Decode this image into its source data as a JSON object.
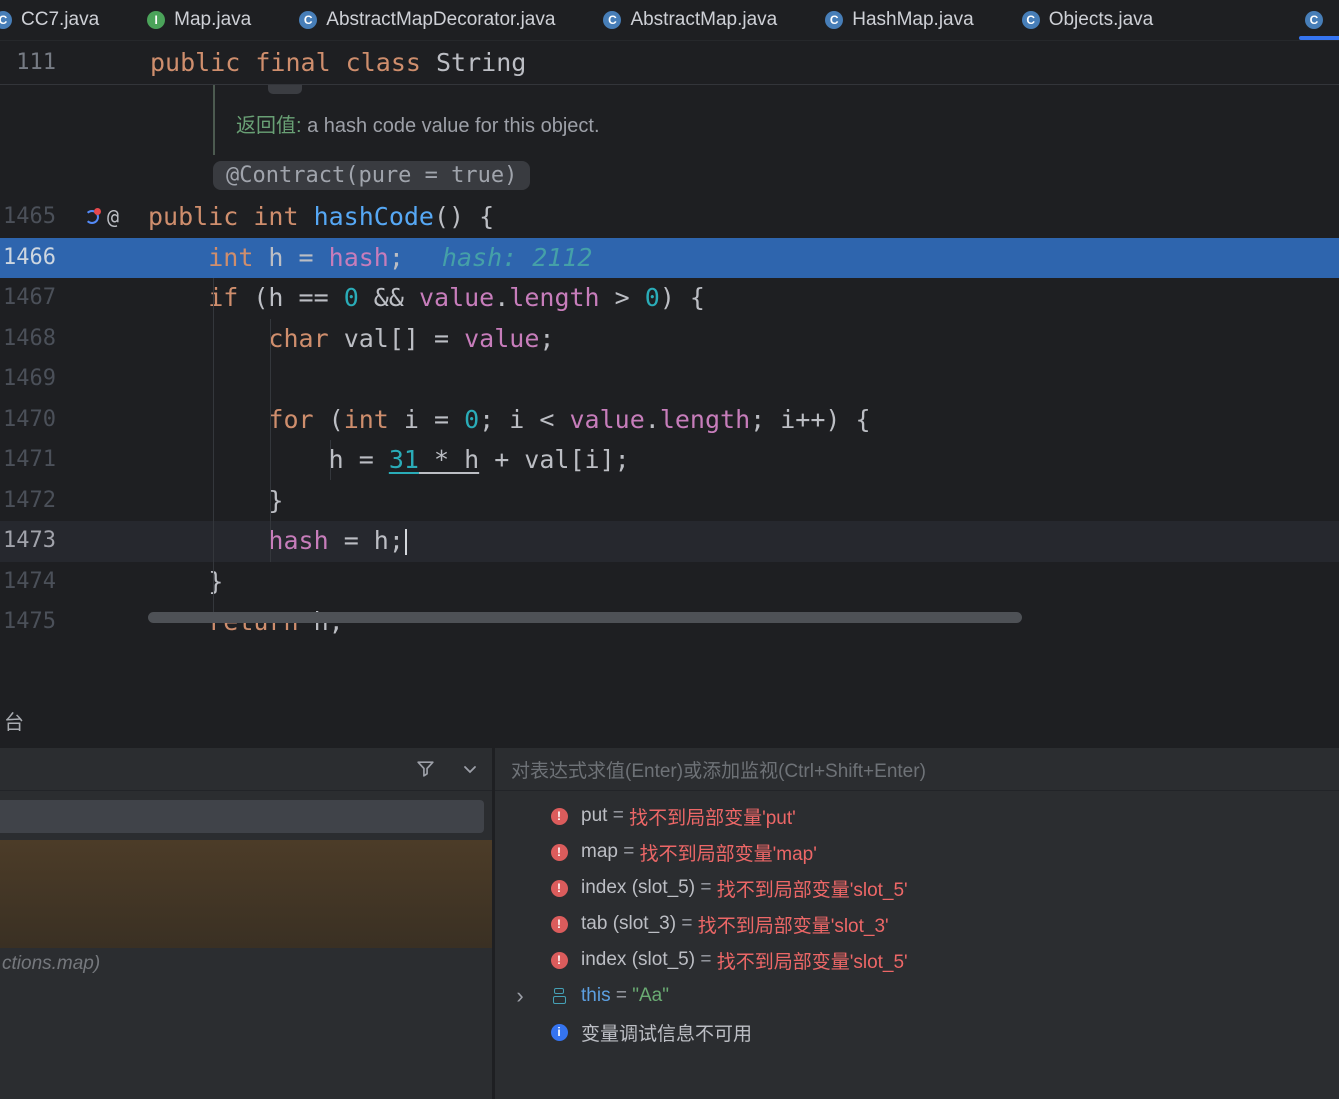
{
  "status_colors": {
    "error": "#DB5C5C",
    "info": "#3574F0",
    "execution_line_bg": "#2E65AE",
    "active_tab_underline": "#3574F0",
    "error_text": "#ED6767",
    "string_green": "#6AAB73"
  },
  "tabs": [
    {
      "label": "CC7.java",
      "icon_letter": "C",
      "icon_color": "#477EB8",
      "icon_kind": "class"
    },
    {
      "label": "Map.java",
      "icon_letter": "I",
      "icon_color": "#4BA35A",
      "icon_kind": "interface"
    },
    {
      "label": "AbstractMapDecorator.java",
      "icon_letter": "C",
      "icon_color": "#477EB8",
      "icon_kind": "class"
    },
    {
      "label": "AbstractMap.java",
      "icon_letter": "C",
      "icon_color": "#477EB8",
      "icon_kind": "class"
    },
    {
      "label": "HashMap.java",
      "icon_letter": "C",
      "icon_color": "#477EB8",
      "icon_kind": "class"
    },
    {
      "label": "Objects.java",
      "icon_letter": "C",
      "icon_color": "#477EB8",
      "icon_kind": "class"
    },
    {
      "label": "",
      "icon_letter": "C",
      "icon_color": "#477EB8",
      "icon_kind": "class",
      "active": true
    }
  ],
  "sticky": {
    "line_number": "111",
    "keyword_text": "public final class ",
    "class_name": "String"
  },
  "editor": {
    "doc": {
      "label": "返回值:",
      "text": " a hash code value for this object."
    },
    "annotation": "@Contract(pure = true)",
    "lines": [
      {
        "num": "1465",
        "gutter_icons": true,
        "tokens": [
          [
            "kw",
            "public int "
          ],
          [
            "fn",
            "hashCode"
          ],
          [
            "pl",
            "() {"
          ]
        ]
      },
      {
        "num": "1466",
        "state": "exec",
        "tokens": [
          [
            "pl",
            "    "
          ],
          [
            "kw",
            "int"
          ],
          [
            "pl",
            " h = "
          ],
          [
            "fld",
            "hash"
          ],
          [
            "pl",
            ";"
          ],
          [
            "hint",
            "hash: 2112"
          ]
        ]
      },
      {
        "num": "1467",
        "tokens": [
          [
            "pl",
            "    "
          ],
          [
            "kw",
            "if"
          ],
          [
            "pl",
            " (h == "
          ],
          [
            "num",
            "0"
          ],
          [
            "pl",
            " && "
          ],
          [
            "fld",
            "value"
          ],
          [
            "pl",
            "."
          ],
          [
            "fld",
            "length"
          ],
          [
            "pl",
            " > "
          ],
          [
            "num",
            "0"
          ],
          [
            "pl",
            ") {"
          ]
        ]
      },
      {
        "num": "1468",
        "tokens": [
          [
            "pl",
            "        "
          ],
          [
            "kw",
            "char"
          ],
          [
            "pl",
            " val[] = "
          ],
          [
            "fld",
            "value"
          ],
          [
            "pl",
            ";"
          ]
        ]
      },
      {
        "num": "1469",
        "tokens": []
      },
      {
        "num": "1470",
        "tokens": [
          [
            "pl",
            "        "
          ],
          [
            "kw",
            "for"
          ],
          [
            "pl",
            " ("
          ],
          [
            "kw",
            "int"
          ],
          [
            "pl",
            " i = "
          ],
          [
            "num",
            "0"
          ],
          [
            "pl",
            "; i < "
          ],
          [
            "fld",
            "value"
          ],
          [
            "pl",
            "."
          ],
          [
            "fld",
            "length"
          ],
          [
            "pl",
            "; i++) {"
          ]
        ]
      },
      {
        "num": "1471",
        "tokens": [
          [
            "pl",
            "            h = "
          ],
          [
            "num u",
            "31"
          ],
          [
            "pl u",
            " * h"
          ],
          [
            "pl",
            " + val[i];"
          ]
        ]
      },
      {
        "num": "1472",
        "tokens": [
          [
            "pl",
            "        }"
          ]
        ]
      },
      {
        "num": "1473",
        "state": "caret-line",
        "tokens": [
          [
            "pl",
            "        "
          ],
          [
            "fld",
            "hash"
          ],
          [
            "pl",
            " = h;"
          ],
          [
            "caret",
            ""
          ]
        ]
      },
      {
        "num": "1474",
        "tokens": [
          [
            "pl",
            "    }"
          ]
        ]
      },
      {
        "num": "1475",
        "tokens": [
          [
            "pl",
            "    "
          ],
          [
            "kw",
            "return"
          ],
          [
            "pl",
            " h;"
          ]
        ]
      }
    ]
  },
  "debug": {
    "tool_tab_fragment": "台",
    "watch_placeholder": "对表达式求值(Enter)或添加监视(Ctrl+Shift+Enter)",
    "frames_clipped_text": "ctions.map)",
    "watches": [
      {
        "kind": "error",
        "name": "put",
        "sep": " = ",
        "value": "找不到局部变量'put'"
      },
      {
        "kind": "error",
        "name": "map",
        "sep": " = ",
        "value": "找不到局部变量'map'"
      },
      {
        "kind": "error",
        "name": "index (slot_5)",
        "sep": " = ",
        "value": "找不到局部变量'slot_5'"
      },
      {
        "kind": "error",
        "name": "tab (slot_3)",
        "sep": " = ",
        "value": "找不到局部变量'slot_3'"
      },
      {
        "kind": "error",
        "name": "index (slot_5)",
        "sep": " = ",
        "value": "找不到局部变量'slot_5'"
      },
      {
        "kind": "this",
        "name": "this",
        "sep": " = ",
        "value": "\"Aa\"",
        "expandable": true
      },
      {
        "kind": "info",
        "name": "",
        "sep": "",
        "value": "变量调试信息不可用"
      }
    ]
  }
}
